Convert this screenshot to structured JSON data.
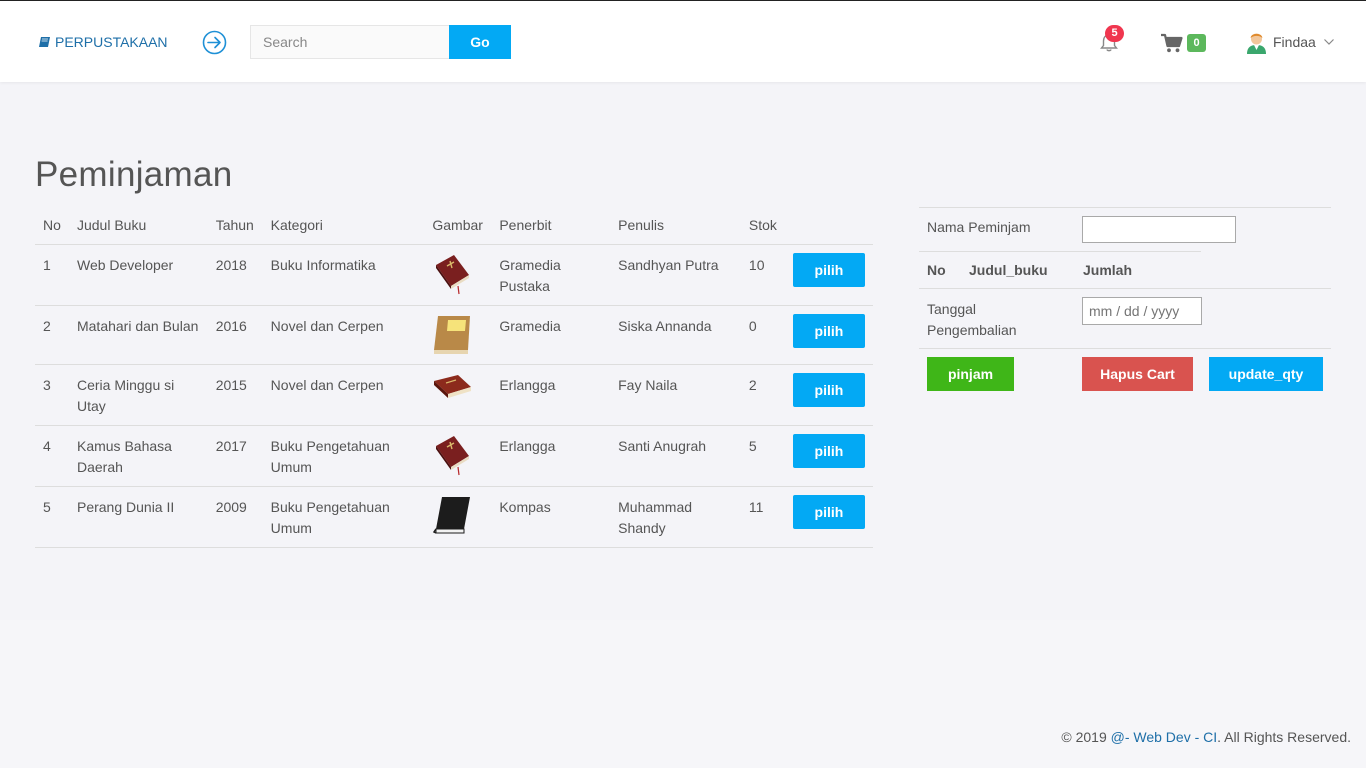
{
  "header": {
    "brand": "PERPUSTAKAAN",
    "search": {
      "placeholder": "Search",
      "value": ""
    },
    "go_label": "Go",
    "notifications_count": "5",
    "cart_count": "0",
    "user_name": "Findaa"
  },
  "page": {
    "title": "Peminjaman"
  },
  "books_table": {
    "headers": [
      "No",
      "Judul Buku",
      "Tahun",
      "Kategori",
      "Gambar",
      "Penerbit",
      "Penulis",
      "Stok",
      ""
    ],
    "rows": [
      {
        "no": "1",
        "judul": "Web Developer",
        "tahun": "2018",
        "kategori": "Buku Informatika",
        "image": "book-red-bible",
        "penerbit": "Gramedia Pustaka",
        "penulis": "Sandhyan Putra",
        "stok": "10",
        "action": "pilih"
      },
      {
        "no": "2",
        "judul": "Matahari dan Bulan",
        "tahun": "2016",
        "kategori": "Novel dan Cerpen",
        "image": "book-brown-note",
        "penerbit": "Gramedia",
        "penulis": "Siska Annanda",
        "stok": "0",
        "action": "pilih"
      },
      {
        "no": "3",
        "judul": "Ceria Minggu si Utay",
        "tahun": "2015",
        "kategori": "Novel dan Cerpen",
        "image": "book-red-flat",
        "penerbit": "Erlangga",
        "penulis": "Fay Naila",
        "stok": "2",
        "action": "pilih"
      },
      {
        "no": "4",
        "judul": "Kamus Bahasa Daerah",
        "tahun": "2017",
        "kategori": "Buku Pengetahuan Umum",
        "image": "book-red-bible",
        "penerbit": "Erlangga",
        "penulis": "Santi Anugrah",
        "stok": "5",
        "action": "pilih"
      },
      {
        "no": "5",
        "judul": "Perang Dunia II",
        "tahun": "2009",
        "kategori": "Buku Pengetahuan Umum",
        "image": "book-black",
        "penerbit": "Kompas",
        "penulis": "Muhammad Shandy",
        "stok": "11",
        "action": "pilih"
      }
    ]
  },
  "side_panel": {
    "nama_label": "Nama Peminjam",
    "nama_value": "",
    "cart_headers": [
      "No",
      "Judul_buku",
      "Jumlah"
    ],
    "tanggal_label": "Tanggal Pengembalian",
    "date_placeholder": "mm / dd / yyyy",
    "pinjam_label": "pinjam",
    "hapus_label": "Hapus Cart",
    "update_label": "update_qty"
  },
  "footer": {
    "prefix": "© 2019 ",
    "link": "@- Web Dev - CI",
    "suffix": ". All Rights Reserved."
  },
  "colors": {
    "accent": "#03a9f4",
    "brand": "#1e6fa8",
    "success": "#3fb618",
    "danger": "#d9534f",
    "badge_red": "#f0364f",
    "badge_green": "#5cb85c"
  }
}
